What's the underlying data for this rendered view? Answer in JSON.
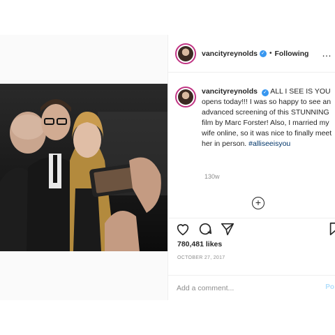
{
  "post": {
    "username": "vancityreynolds",
    "verified_icon": "verified-badge-icon",
    "separator": "•",
    "follow_status": "Following",
    "more_icon": "…",
    "caption": {
      "username": "vancityreynolds",
      "text": "ALL I SEE IS YOU opens today!!! I was so happy to see an advanced screening of this STUNNING film by Marc Forster! Also, I married my wife online, so it was nice to finally meet her in person.",
      "hashtag": "#alliseeisyou"
    },
    "time_ago": "130w",
    "load_more": "+",
    "likes": "780,481 likes",
    "date": "OCTOBER 27, 2017",
    "comment_placeholder": "Add a comment...",
    "post_button": "Po"
  },
  "colors": {
    "accent_link": "#3897f0",
    "verified": "#3897f0",
    "muted": "#8e8e8e"
  },
  "icons": {
    "like": "heart-icon",
    "comment": "comment-icon",
    "share": "paper-plane-icon",
    "save": "bookmark-icon"
  }
}
